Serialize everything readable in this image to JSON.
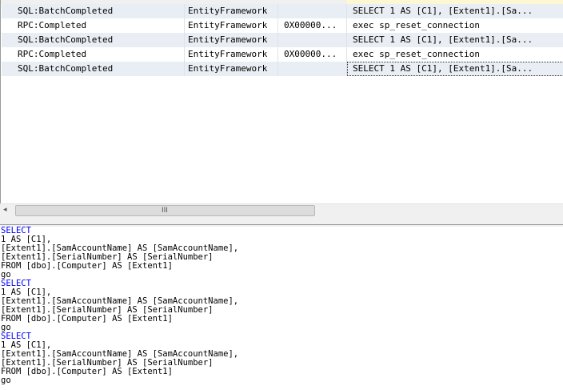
{
  "trace_grid": {
    "rows": [
      {
        "event_class": "SQL:BatchCompleted",
        "application": "EntityFramework",
        "binary_data": "",
        "text_data": "SELECT    1 AS [C1],    [Extent1].[Sa...",
        "style": "alt"
      },
      {
        "event_class": "RPC:Completed",
        "application": "EntityFramework",
        "binary_data": "0X00000...",
        "text_data": "exec sp_reset_connection",
        "style": "white"
      },
      {
        "event_class": "SQL:BatchCompleted",
        "application": "EntityFramework",
        "binary_data": "",
        "text_data": "SELECT    1 AS [C1],    [Extent1].[Sa...",
        "style": "alt"
      },
      {
        "event_class": "RPC:Completed",
        "application": "EntityFramework",
        "binary_data": "0X00000...",
        "text_data": "exec sp_reset_connection",
        "style": "white"
      },
      {
        "event_class": "SQL:BatchCompleted",
        "application": "EntityFramework",
        "binary_data": "",
        "text_data": "SELECT    1 AS [C1],    [Extent1].[Sa...",
        "style": "alt",
        "selected": true
      }
    ]
  },
  "scrollbar": {
    "left_arrow": "◂",
    "grip": "III"
  },
  "sql_text": {
    "lines": [
      {
        "text": "SELECT",
        "keyword": true
      },
      {
        "text": "1 AS [C1],",
        "keyword": false
      },
      {
        "text": "[Extent1].[SamAccountName] AS [SamAccountName],",
        "keyword": false
      },
      {
        "text": "[Extent1].[SerialNumber] AS [SerialNumber]",
        "keyword": false
      },
      {
        "text": "FROM [dbo].[Computer] AS [Extent1]",
        "keyword": false
      },
      {
        "text": "go",
        "keyword": false
      },
      {
        "text": "SELECT",
        "keyword": true
      },
      {
        "text": "1 AS [C1],",
        "keyword": false
      },
      {
        "text": "[Extent1].[SamAccountName] AS [SamAccountName],",
        "keyword": false
      },
      {
        "text": "[Extent1].[SerialNumber] AS [SerialNumber]",
        "keyword": false
      },
      {
        "text": "FROM [dbo].[Computer] AS [Extent1]",
        "keyword": false
      },
      {
        "text": "go",
        "keyword": false
      },
      {
        "text": "SELECT",
        "keyword": true
      },
      {
        "text": "1 AS [C1],",
        "keyword": false
      },
      {
        "text": "[Extent1].[SamAccountName] AS [SamAccountName],",
        "keyword": false
      },
      {
        "text": "[Extent1].[SerialNumber] AS [SerialNumber]",
        "keyword": false
      },
      {
        "text": "FROM [dbo].[Computer] AS [Extent1]",
        "keyword": false
      },
      {
        "text": "go",
        "keyword": false
      }
    ]
  },
  "colors": {
    "keyword": "#0000ff",
    "row_alt": "#e9eef4"
  }
}
